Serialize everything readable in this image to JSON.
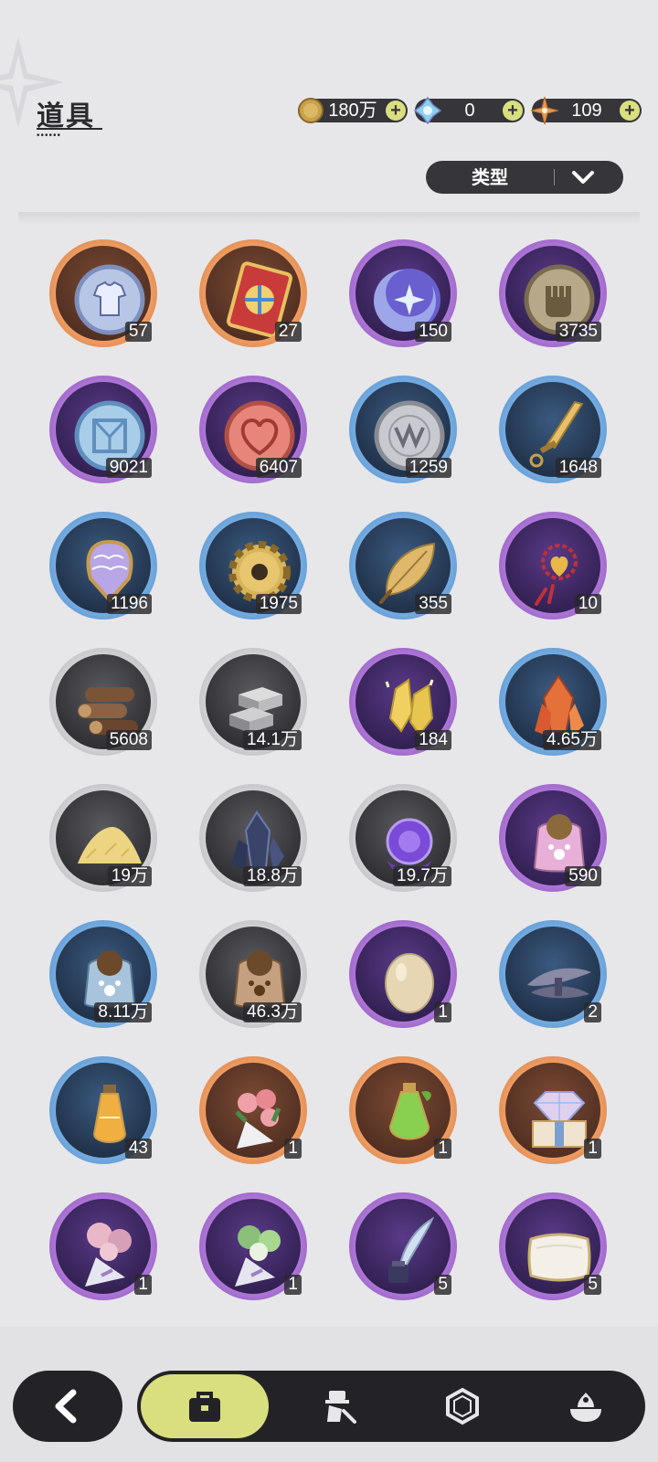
{
  "header": {
    "title": "道具"
  },
  "currencies": [
    {
      "icon": "gold-coin-icon",
      "value": "180万"
    },
    {
      "icon": "crystal-gem-icon",
      "value": "0"
    },
    {
      "icon": "orange-star-icon",
      "value": "109"
    }
  ],
  "filter": {
    "label": "类型"
  },
  "items": [
    {
      "icon": "outfit-token-icon",
      "rarity": "orange",
      "qty": "57"
    },
    {
      "icon": "gacha-ticket-icon",
      "rarity": "orange",
      "qty": "27"
    },
    {
      "icon": "star-moon-orb-icon",
      "rarity": "purple",
      "qty": "150"
    },
    {
      "icon": "fist-coin-icon",
      "rarity": "purple",
      "qty": "3735"
    },
    {
      "icon": "blue-rune-coin-icon",
      "rarity": "purple",
      "qty": "9021"
    },
    {
      "icon": "heart-coin-icon",
      "rarity": "purple",
      "qty": "6407"
    },
    {
      "icon": "silver-crest-coin-icon",
      "rarity": "blue",
      "qty": "1259"
    },
    {
      "icon": "golden-blade-icon",
      "rarity": "blue",
      "qty": "1648"
    },
    {
      "icon": "scale-mirror-icon",
      "rarity": "blue",
      "qty": "1196"
    },
    {
      "icon": "gear-coin-icon",
      "rarity": "blue",
      "qty": "1975"
    },
    {
      "icon": "golden-leaf-icon",
      "rarity": "blue",
      "qty": "355"
    },
    {
      "icon": "heart-knot-charm-icon",
      "rarity": "purple",
      "qty": "10"
    },
    {
      "icon": "wood-logs-icon",
      "rarity": "gray",
      "qty": "5608"
    },
    {
      "icon": "stone-bricks-icon",
      "rarity": "gray",
      "qty": "14.1万"
    },
    {
      "icon": "gold-crystal-icon",
      "rarity": "purple",
      "qty": "184"
    },
    {
      "icon": "red-crystal-icon",
      "rarity": "blue",
      "qty": "4.65万"
    },
    {
      "icon": "sand-pile-icon",
      "rarity": "gray",
      "qty": "19万"
    },
    {
      "icon": "dark-crystal-icon",
      "rarity": "gray",
      "qty": "18.8万"
    },
    {
      "icon": "purple-orb-icon",
      "rarity": "gray",
      "qty": "19.7万"
    },
    {
      "icon": "pink-pet-food-bag-icon",
      "rarity": "purple",
      "qty": "590"
    },
    {
      "icon": "blue-pet-food-bag-icon",
      "rarity": "blue",
      "qty": "8.11万"
    },
    {
      "icon": "brown-pet-food-bag-icon",
      "rarity": "gray",
      "qty": "46.3万"
    },
    {
      "icon": "egg-icon",
      "rarity": "purple",
      "qty": "1"
    },
    {
      "icon": "feather-bundle-icon",
      "rarity": "blue",
      "qty": "2"
    },
    {
      "icon": "potion-vial-icon",
      "rarity": "blue",
      "qty": "43"
    },
    {
      "icon": "rose-bouquet-icon",
      "rarity": "orange",
      "qty": "1"
    },
    {
      "icon": "green-potion-icon",
      "rarity": "orange",
      "qty": "1"
    },
    {
      "icon": "diamond-gift-box-icon",
      "rarity": "orange",
      "qty": "1"
    },
    {
      "icon": "blossom-bouquet-icon",
      "rarity": "purple",
      "qty": "1"
    },
    {
      "icon": "green-bouquet-icon",
      "rarity": "purple",
      "qty": "1"
    },
    {
      "icon": "quill-ink-icon",
      "rarity": "purple",
      "qty": "5"
    },
    {
      "icon": "pillow-icon",
      "rarity": "purple",
      "qty": "5"
    }
  ],
  "nav": {
    "back_icon": "back-arrow-icon",
    "tabs": [
      {
        "icon": "bag-icon",
        "active": true
      },
      {
        "icon": "character-gear-icon",
        "active": false
      },
      {
        "icon": "hexagon-gem-icon",
        "active": false
      },
      {
        "icon": "food-bowl-icon",
        "active": false
      }
    ]
  },
  "colors": {
    "background": "#e7e7e9",
    "dark": "#35353a",
    "accent": "#d9df7e",
    "rarity_orange": "#e08a50",
    "rarity_purple": "#9a5fcf",
    "rarity_blue": "#5a98d6",
    "rarity_gray": "#bcbcbf"
  }
}
